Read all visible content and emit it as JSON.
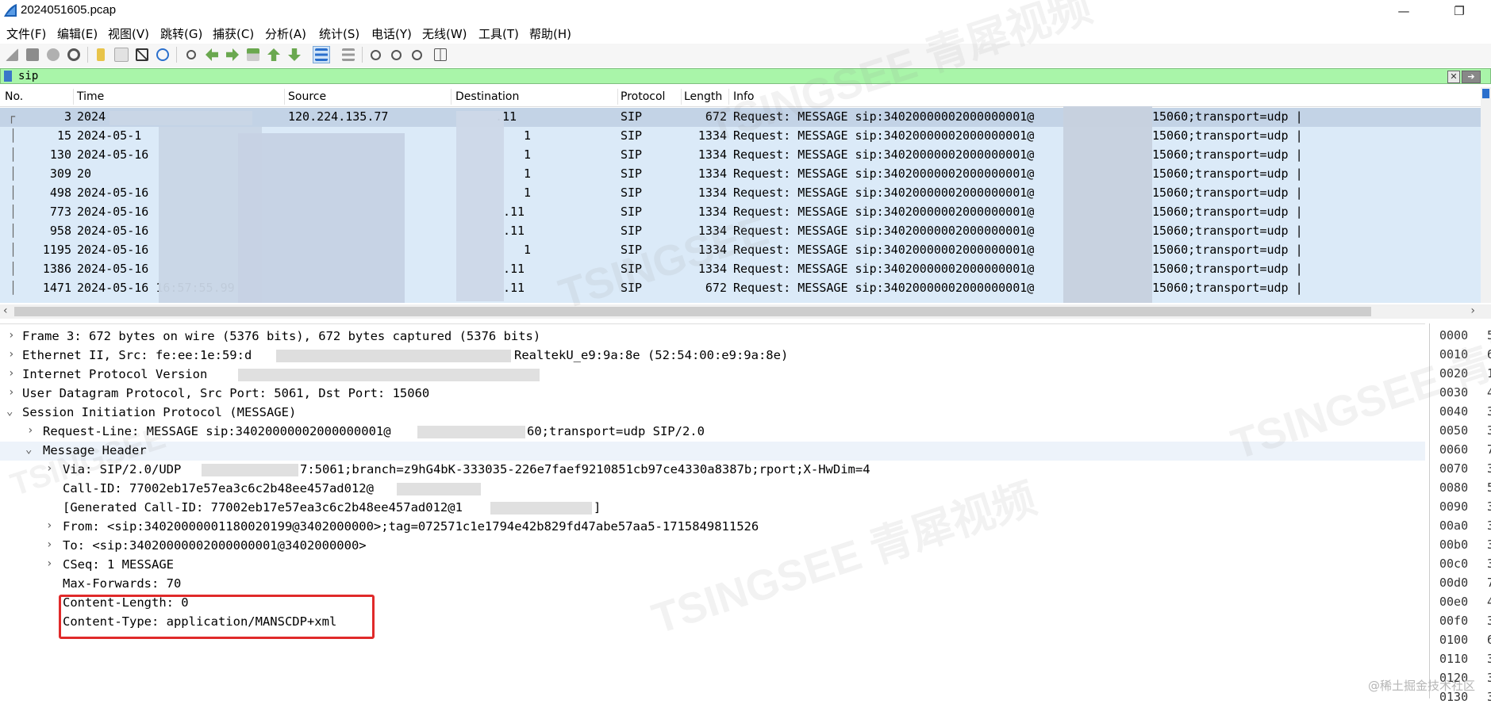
{
  "window": {
    "title": "2024051605.pcap",
    "minimize": "—",
    "restore": "❐"
  },
  "menu": [
    "文件(F)",
    "编辑(E)",
    "视图(V)",
    "跳转(G)",
    "捕获(C)",
    "分析(A)",
    "统计(S)",
    "电话(Y)",
    "无线(W)",
    "工具(T)",
    "帮助(H)"
  ],
  "filter": {
    "value": "sip"
  },
  "packet_list": {
    "columns": [
      "No.",
      "Time",
      "Source",
      "Destination",
      "Protocol",
      "Length",
      "Info"
    ],
    "rows": [
      {
        "no": "3",
        "time": "2024",
        "source": "120.224.135.77",
        "dest": ".11",
        "proto": "SIP",
        "len": "672",
        "info": "Request: MESSAGE sip:34020000002000000001@",
        "tail": "15060;transport=udp  |"
      },
      {
        "no": "15",
        "time": "2024-05-1",
        "source": "",
        "dest": "1",
        "proto": "SIP",
        "len": "1334",
        "info": "Request: MESSAGE sip:34020000002000000001@",
        "tail": "15060;transport=udp  |"
      },
      {
        "no": "130",
        "time": "2024-05-16",
        "source": "",
        "dest": "1",
        "proto": "SIP",
        "len": "1334",
        "info": "Request: MESSAGE sip:34020000002000000001@",
        "tail": "15060;transport=udp  |"
      },
      {
        "no": "309",
        "time": "20",
        "source": "",
        "dest": "1",
        "proto": "SIP",
        "len": "1334",
        "info": "Request: MESSAGE sip:34020000002000000001@",
        "tail": "15060;transport=udp  |"
      },
      {
        "no": "498",
        "time": "2024-05-16",
        "source": "",
        "dest": "1",
        "proto": "SIP",
        "len": "1334",
        "info": "Request: MESSAGE sip:34020000002000000001@",
        "tail": "15060;transport=udp  |"
      },
      {
        "no": "773",
        "time": "2024-05-16",
        "source": "",
        "dest": ".11",
        "proto": "SIP",
        "len": "1334",
        "info": "Request: MESSAGE sip:34020000002000000001@",
        "tail": "15060;transport=udp  |"
      },
      {
        "no": "958",
        "time": "2024-05-16",
        "source": "",
        "dest": ".11",
        "proto": "SIP",
        "len": "1334",
        "info": "Request: MESSAGE sip:34020000002000000001@",
        "tail": "15060;transport=udp  |"
      },
      {
        "no": "1195",
        "time": "2024-05-16",
        "source": "",
        "dest": "1",
        "proto": "SIP",
        "len": "1334",
        "info": "Request: MESSAGE sip:34020000002000000001@",
        "tail": "15060;transport=udp  |"
      },
      {
        "no": "1386",
        "time": "2024-05-16",
        "source": "",
        "dest": ".11",
        "proto": "SIP",
        "len": "1334",
        "info": "Request: MESSAGE sip:34020000002000000001@",
        "tail": "15060;transport=udp  |"
      },
      {
        "no": "1471",
        "time": "2024-05-16 16:57:55.99",
        "source": "",
        "dest": ".11",
        "proto": "SIP",
        "len": "672",
        "info": "Request: MESSAGE sip:34020000002000000001@",
        "tail": "15060;transport=udp  |"
      }
    ]
  },
  "details": {
    "lines": [
      "Frame 3: 672 bytes on wire (5376 bits), 672 bytes captured (5376 bits)",
      "Ethernet II, Src: fe:ee:1e:59:d",
      "RealtekU_e9:9a:8e (52:54:00:e9:9a:8e)",
      "Internet Protocol Version",
      "User Datagram Protocol, Src Port: 5061, Dst Port: 15060",
      "Session Initiation Protocol (MESSAGE)",
      "Request-Line: MESSAGE sip:34020000002000000001@",
      "60;transport=udp SIP/2.0",
      "Message Header",
      "Via: SIP/2.0/UDP",
      "7:5061;branch=z9hG4bK-333035-226e7faef9210851cb97ce4330a8387b;rport;X-HwDim=4",
      "Call-ID: 77002eb17e57ea3c6c2b48ee457ad012@",
      "[Generated Call-ID: 77002eb17e57ea3c6c2b48ee457ad012@1",
      "]",
      "From: <sip:34020000001180020199@3402000000>;tag=072571c1e1794e42b829fd47abe57aa5-1715849811526",
      "To: <sip:34020000002000000001@3402000000>",
      "CSeq: 1 MESSAGE",
      "Max-Forwards: 70",
      "Content-Length: 0",
      "Content-Type: application/MANSCDP+xml"
    ]
  },
  "bytes": [
    "0000",
    "0010",
    "0020",
    "0030",
    "0040",
    "0050",
    "0060",
    "0070",
    "0080",
    "0090",
    "00a0",
    "00b0",
    "00c0",
    "00d0",
    "00e0",
    "00f0",
    "0100",
    "0110",
    "0120",
    "0130"
  ],
  "bytes_right": [
    "5",
    "6",
    "1",
    "4",
    "3",
    "3",
    "7",
    "3",
    "5",
    "3",
    "3",
    "3",
    "3",
    "7",
    "4",
    "3",
    "6",
    "3",
    "3",
    "3"
  ],
  "watermarks": [
    "TSINGSEE 青犀视频",
    "TSINGSEE",
    "TSINGSEE 青犀视频",
    "TSINGSEE 青犀视频",
    "TSINGSEE"
  ],
  "credit": "@稀土掘金技术社区",
  "colors": {
    "filter_bg": "#a9f5a9",
    "row_bg": "#dbeaf8",
    "row_sel": "#c3d3e6",
    "highlight_box": "#e02a2a"
  }
}
